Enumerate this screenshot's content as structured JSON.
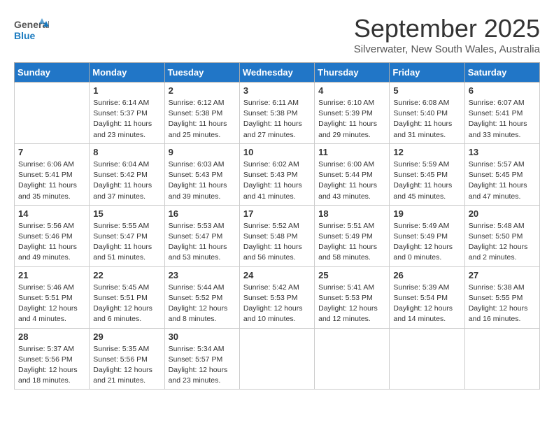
{
  "header": {
    "logo": {
      "general": "General",
      "blue": "Blue"
    },
    "title": "September 2025",
    "location": "Silverwater, New South Wales, Australia"
  },
  "weekdays": [
    "Sunday",
    "Monday",
    "Tuesday",
    "Wednesday",
    "Thursday",
    "Friday",
    "Saturday"
  ],
  "weeks": [
    [
      {
        "day": "",
        "info": ""
      },
      {
        "day": "1",
        "info": "Sunrise: 6:14 AM\nSunset: 5:37 PM\nDaylight: 11 hours\nand 23 minutes."
      },
      {
        "day": "2",
        "info": "Sunrise: 6:12 AM\nSunset: 5:38 PM\nDaylight: 11 hours\nand 25 minutes."
      },
      {
        "day": "3",
        "info": "Sunrise: 6:11 AM\nSunset: 5:38 PM\nDaylight: 11 hours\nand 27 minutes."
      },
      {
        "day": "4",
        "info": "Sunrise: 6:10 AM\nSunset: 5:39 PM\nDaylight: 11 hours\nand 29 minutes."
      },
      {
        "day": "5",
        "info": "Sunrise: 6:08 AM\nSunset: 5:40 PM\nDaylight: 11 hours\nand 31 minutes."
      },
      {
        "day": "6",
        "info": "Sunrise: 6:07 AM\nSunset: 5:41 PM\nDaylight: 11 hours\nand 33 minutes."
      }
    ],
    [
      {
        "day": "7",
        "info": "Sunrise: 6:06 AM\nSunset: 5:41 PM\nDaylight: 11 hours\nand 35 minutes."
      },
      {
        "day": "8",
        "info": "Sunrise: 6:04 AM\nSunset: 5:42 PM\nDaylight: 11 hours\nand 37 minutes."
      },
      {
        "day": "9",
        "info": "Sunrise: 6:03 AM\nSunset: 5:43 PM\nDaylight: 11 hours\nand 39 minutes."
      },
      {
        "day": "10",
        "info": "Sunrise: 6:02 AM\nSunset: 5:43 PM\nDaylight: 11 hours\nand 41 minutes."
      },
      {
        "day": "11",
        "info": "Sunrise: 6:00 AM\nSunset: 5:44 PM\nDaylight: 11 hours\nand 43 minutes."
      },
      {
        "day": "12",
        "info": "Sunrise: 5:59 AM\nSunset: 5:45 PM\nDaylight: 11 hours\nand 45 minutes."
      },
      {
        "day": "13",
        "info": "Sunrise: 5:57 AM\nSunset: 5:45 PM\nDaylight: 11 hours\nand 47 minutes."
      }
    ],
    [
      {
        "day": "14",
        "info": "Sunrise: 5:56 AM\nSunset: 5:46 PM\nDaylight: 11 hours\nand 49 minutes."
      },
      {
        "day": "15",
        "info": "Sunrise: 5:55 AM\nSunset: 5:47 PM\nDaylight: 11 hours\nand 51 minutes."
      },
      {
        "day": "16",
        "info": "Sunrise: 5:53 AM\nSunset: 5:47 PM\nDaylight: 11 hours\nand 53 minutes."
      },
      {
        "day": "17",
        "info": "Sunrise: 5:52 AM\nSunset: 5:48 PM\nDaylight: 11 hours\nand 56 minutes."
      },
      {
        "day": "18",
        "info": "Sunrise: 5:51 AM\nSunset: 5:49 PM\nDaylight: 11 hours\nand 58 minutes."
      },
      {
        "day": "19",
        "info": "Sunrise: 5:49 AM\nSunset: 5:49 PM\nDaylight: 12 hours\nand 0 minutes."
      },
      {
        "day": "20",
        "info": "Sunrise: 5:48 AM\nSunset: 5:50 PM\nDaylight: 12 hours\nand 2 minutes."
      }
    ],
    [
      {
        "day": "21",
        "info": "Sunrise: 5:46 AM\nSunset: 5:51 PM\nDaylight: 12 hours\nand 4 minutes."
      },
      {
        "day": "22",
        "info": "Sunrise: 5:45 AM\nSunset: 5:51 PM\nDaylight: 12 hours\nand 6 minutes."
      },
      {
        "day": "23",
        "info": "Sunrise: 5:44 AM\nSunset: 5:52 PM\nDaylight: 12 hours\nand 8 minutes."
      },
      {
        "day": "24",
        "info": "Sunrise: 5:42 AM\nSunset: 5:53 PM\nDaylight: 12 hours\nand 10 minutes."
      },
      {
        "day": "25",
        "info": "Sunrise: 5:41 AM\nSunset: 5:53 PM\nDaylight: 12 hours\nand 12 minutes."
      },
      {
        "day": "26",
        "info": "Sunrise: 5:39 AM\nSunset: 5:54 PM\nDaylight: 12 hours\nand 14 minutes."
      },
      {
        "day": "27",
        "info": "Sunrise: 5:38 AM\nSunset: 5:55 PM\nDaylight: 12 hours\nand 16 minutes."
      }
    ],
    [
      {
        "day": "28",
        "info": "Sunrise: 5:37 AM\nSunset: 5:56 PM\nDaylight: 12 hours\nand 18 minutes."
      },
      {
        "day": "29",
        "info": "Sunrise: 5:35 AM\nSunset: 5:56 PM\nDaylight: 12 hours\nand 21 minutes."
      },
      {
        "day": "30",
        "info": "Sunrise: 5:34 AM\nSunset: 5:57 PM\nDaylight: 12 hours\nand 23 minutes."
      },
      {
        "day": "",
        "info": ""
      },
      {
        "day": "",
        "info": ""
      },
      {
        "day": "",
        "info": ""
      },
      {
        "day": "",
        "info": ""
      }
    ]
  ]
}
